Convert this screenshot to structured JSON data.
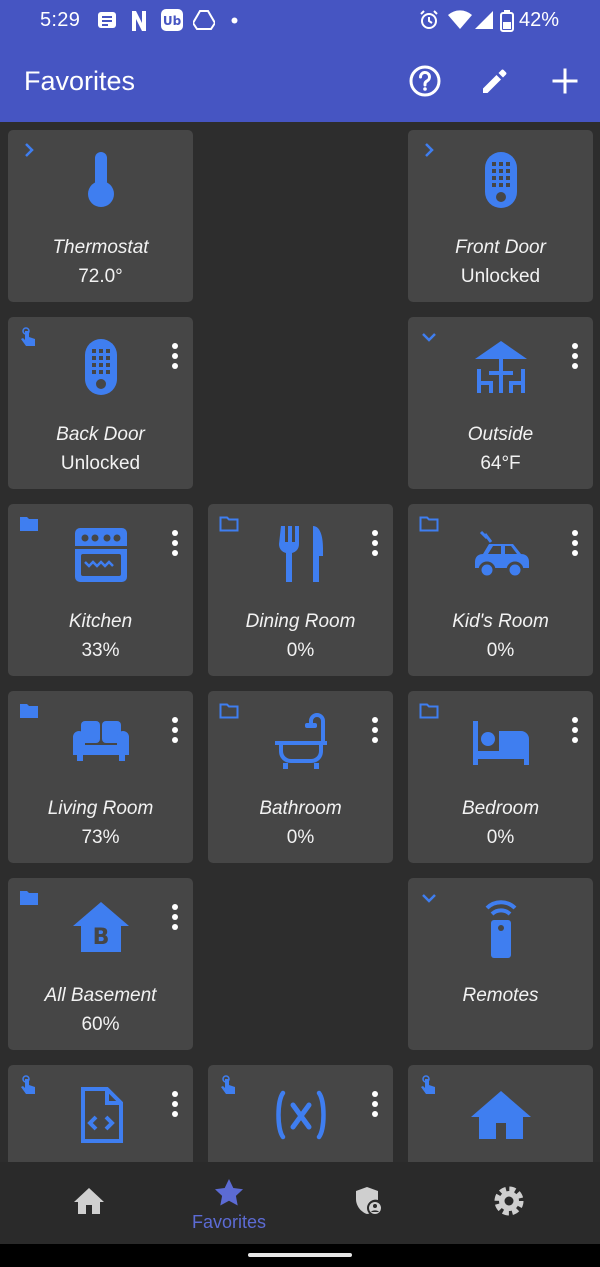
{
  "status_bar": {
    "time": "5:29",
    "battery": "42%",
    "notification_icons": [
      "message-icon",
      "netflix-icon",
      "app-icon",
      "drive-icon",
      "dot-icon"
    ],
    "system_icons": [
      "alarm-icon",
      "wifi-icon",
      "signal-icon",
      "battery-icon"
    ]
  },
  "app_bar": {
    "title": "Favorites",
    "actions": [
      "help-icon",
      "edit-icon",
      "add-icon"
    ]
  },
  "colors": {
    "primary": "#4655c2",
    "accent_icon": "#3f7ef0",
    "tile": "#464646",
    "background": "#2d2d2d",
    "nav_selected": "#5c6bd4",
    "nav_icon": "#cfcfcf"
  },
  "tiles": [
    {
      "name": "Thermostat",
      "status": "72.0°",
      "icon": "thermometer-icon",
      "badge": "chevron-right-icon"
    },
    {
      "name": "Front Door",
      "status": "Unlocked",
      "icon": "keypad-lock-icon",
      "badge": "chevron-right-icon"
    },
    {
      "name": "Back Door",
      "status": "Unlocked",
      "icon": "keypad-lock-icon",
      "badge": "touch-icon"
    },
    {
      "name": "Outside",
      "status": "64°F",
      "icon": "patio-table-icon",
      "badge": "chevron-down-icon"
    },
    {
      "name": "Kitchen",
      "status": "33%",
      "icon": "stove-icon",
      "badge": "folder-filled-icon"
    },
    {
      "name": "Dining Room",
      "status": "0%",
      "icon": "fork-knife-icon",
      "badge": "folder-outline-icon"
    },
    {
      "name": "Kid's Room",
      "status": "0%",
      "icon": "toy-car-icon",
      "badge": "folder-outline-icon"
    },
    {
      "name": "Living Room",
      "status": "73%",
      "icon": "sofa-icon",
      "badge": "folder-filled-icon"
    },
    {
      "name": "Bathroom",
      "status": "0%",
      "icon": "bathtub-icon",
      "badge": "folder-outline-icon"
    },
    {
      "name": "Bedroom",
      "status": "0%",
      "icon": "bed-icon",
      "badge": "folder-outline-icon"
    },
    {
      "name": "All Basement",
      "status": "60%",
      "icon": "basement-home-icon",
      "badge": "folder-filled-icon"
    },
    {
      "name": "Remotes",
      "status": "",
      "icon": "remote-icon",
      "badge": "chevron-down-icon"
    },
    {
      "name": "",
      "status": "",
      "icon": "code-file-icon",
      "badge": "touch-icon"
    },
    {
      "name": "",
      "status": "",
      "icon": "variable-icon",
      "badge": "touch-icon"
    },
    {
      "name": "",
      "status": "",
      "icon": "home-icon",
      "badge": "touch-icon"
    }
  ],
  "bottom_nav": {
    "items": [
      {
        "icon": "home-icon",
        "label": ""
      },
      {
        "icon": "star-icon",
        "label": "Favorites",
        "selected": true
      },
      {
        "icon": "security-shield-icon",
        "label": ""
      },
      {
        "icon": "gear-icon",
        "label": ""
      }
    ]
  }
}
